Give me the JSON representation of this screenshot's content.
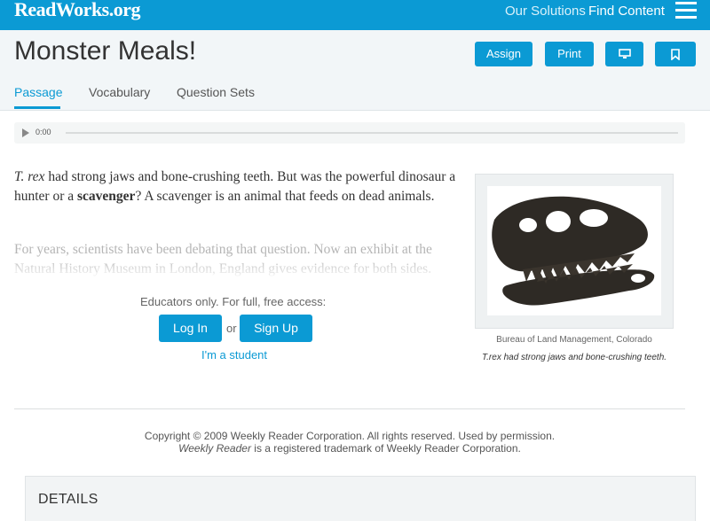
{
  "nav": {
    "logo": "ReadWorks.org",
    "links": [
      "Our Solutions",
      "Find Content"
    ]
  },
  "header": {
    "title": "Monster Meals!",
    "buttons": {
      "assign": "Assign",
      "print": "Print"
    },
    "tabs": [
      "Passage",
      "Vocabulary",
      "Question Sets"
    ],
    "active_tab": "Passage"
  },
  "audio": {
    "time": "0:00"
  },
  "passage": {
    "p1_italic": "T. rex",
    "p1_a": " had strong jaws and bone-crushing teeth. But was the powerful dinosaur a hunter or a ",
    "p1_bold": "scavenger",
    "p1_b": "? A scavenger is an animal that feeds on dead animals.",
    "p2": "For years, scientists have been debating that question. Now an exhibit at the Natural History Museum in London, England gives evidence for both sides."
  },
  "access": {
    "prompt": "Educators only. For full, free access:",
    "login": "Log In",
    "or": "or",
    "signup": "Sign Up",
    "student": "I'm a student"
  },
  "figure": {
    "credit": "Bureau of Land Management, Colorado",
    "caption": "T.rex had strong jaws and bone-crushing teeth."
  },
  "footer": {
    "copyright": "Copyright © 2009 Weekly Reader Corporation. All rights reserved. Used by permission.",
    "trademark_em": "Weekly Reader",
    "trademark_rest": " is a registered trademark of Weekly Reader Corporation."
  },
  "details": {
    "title": "DETAILS"
  },
  "colors": {
    "brand": "#0b9ad4"
  }
}
